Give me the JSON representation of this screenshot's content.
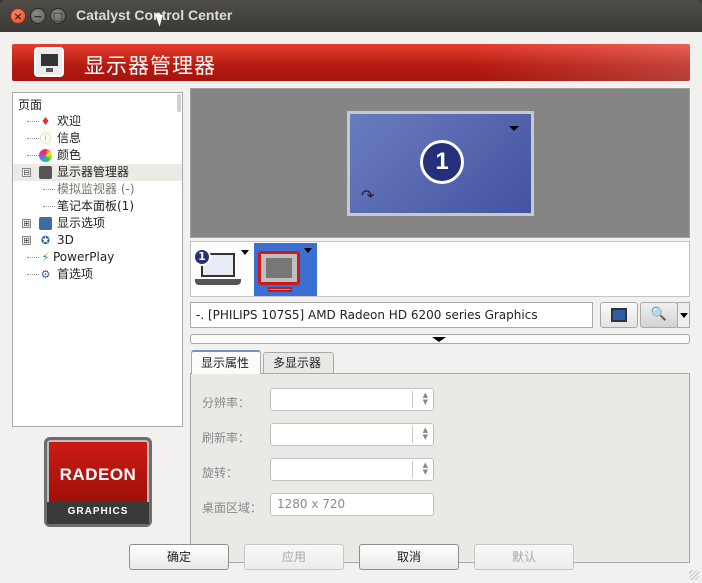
{
  "window": {
    "title": "Catalyst Control Center",
    "controls": {
      "close": "×",
      "minimize": "−",
      "maximize": "□"
    }
  },
  "banner": {
    "title": "显示器管理器",
    "icon": "display-manager-icon"
  },
  "sidebar": {
    "header": "页面",
    "items": [
      {
        "label": "欢迎",
        "icon": "welcome-icon",
        "expander": ""
      },
      {
        "label": "信息",
        "icon": "info-icon",
        "expander": ""
      },
      {
        "label": "颜色",
        "icon": "color-icon",
        "expander": ""
      },
      {
        "label": "显示器管理器",
        "icon": "monitor-icon",
        "expander": "⊟",
        "selected": true
      },
      {
        "label": "模拟监视器 (-)",
        "icon": "",
        "expander": "",
        "dimmed": true
      },
      {
        "label": "笔记本面板(1)",
        "icon": "",
        "expander": ""
      },
      {
        "label": "显示选项",
        "icon": "display-options-icon",
        "expander": "⊞"
      },
      {
        "label": "3D",
        "icon": "3d-icon",
        "expander": "⊞"
      },
      {
        "label": "PowerPlay",
        "icon": "powerplay-icon",
        "expander": ""
      },
      {
        "label": "首选项",
        "icon": "preferences-icon",
        "expander": ""
      }
    ]
  },
  "logo": {
    "top": "RADEON",
    "bottom": "GRAPHICS"
  },
  "preview": {
    "monitor_number": "1"
  },
  "strip": {
    "display1_number": "1"
  },
  "display_selector": {
    "value": "-. [PHILIPS 107S5] AMD Radeon HD 6200 series Graphics",
    "detect_icon": "detect-displays-icon",
    "identify_icon": "identify-magnifier-icon"
  },
  "tabs": [
    {
      "label": "显示属性",
      "active": true
    },
    {
      "label": "多显示器",
      "active": false
    }
  ],
  "properties": {
    "resolution_label": "分辨率：",
    "refresh_label": "刷新率：",
    "rotation_label": "旋转：",
    "desktop_area_label": "桌面区域：",
    "desktop_area_value": "1280 x 720"
  },
  "buttons": {
    "ok": "确定",
    "apply": "应用",
    "cancel": "取消",
    "default": "默认"
  },
  "colors": {
    "banner_red": "#c8221a",
    "accent_blue": "#26307a",
    "selection_blue": "#3b6fd1"
  }
}
